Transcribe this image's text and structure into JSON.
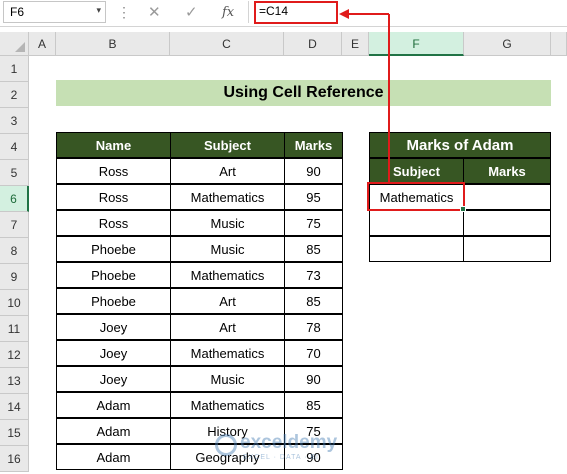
{
  "formula_bar": {
    "name_box": "F6",
    "name_box_arrow": "▾",
    "dots": "⋮",
    "cancel_icon": "✕",
    "enter_icon": "✓",
    "fx_label": "fx",
    "formula": "=C14"
  },
  "columns": [
    "A",
    "B",
    "C",
    "D",
    "E",
    "F",
    "G"
  ],
  "rows": [
    "1",
    "2",
    "3",
    "4",
    "5",
    "6",
    "7",
    "8",
    "9",
    "10",
    "11",
    "12",
    "13",
    "14",
    "15",
    "16"
  ],
  "selected": {
    "column": "F",
    "row": "6"
  },
  "banner_title": "Using Cell Reference",
  "table": {
    "headers": [
      "Name",
      "Subject",
      "Marks"
    ],
    "rows": [
      [
        "Ross",
        "Art",
        "90"
      ],
      [
        "Ross",
        "Mathematics",
        "95"
      ],
      [
        "Ross",
        "Music",
        "75"
      ],
      [
        "Phoebe",
        "Music",
        "85"
      ],
      [
        "Phoebe",
        "Mathematics",
        "73"
      ],
      [
        "Phoebe",
        "Art",
        "85"
      ],
      [
        "Joey",
        "Art",
        "78"
      ],
      [
        "Joey",
        "Mathematics",
        "70"
      ],
      [
        "Joey",
        "Music",
        "90"
      ],
      [
        "Adam",
        "Mathematics",
        "85"
      ],
      [
        "Adam",
        "History",
        "75"
      ],
      [
        "Adam",
        "Geography",
        "90"
      ]
    ]
  },
  "result": {
    "title": "Marks of Adam",
    "headers": [
      "Subject",
      "Marks"
    ],
    "rows": [
      [
        "Mathematics",
        ""
      ],
      [
        "",
        ""
      ],
      [
        "",
        ""
      ]
    ]
  },
  "colors": {
    "header_green": "#375623",
    "banner_green": "#c6e0b4",
    "highlight_red": "#e01b1b",
    "excel_green": "#217346"
  },
  "watermark": {
    "name": "exceldemy",
    "tagline": "EXCEL · DATA · BI"
  }
}
